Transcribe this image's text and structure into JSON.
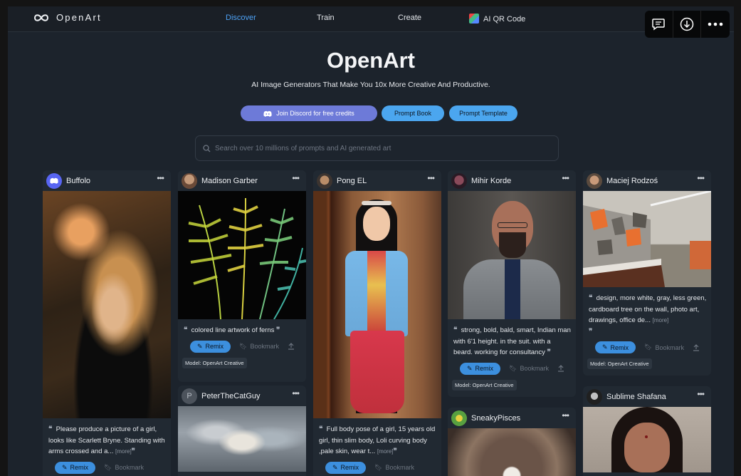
{
  "nav": {
    "brand": "OpenArt",
    "links": [
      "Discover",
      "Train",
      "Create",
      "AI QR Code"
    ],
    "active_link": "Discover",
    "accent_color": "#4ea3f7"
  },
  "hero": {
    "title": "OpenArt",
    "subtitle": "AI Image Generators That Make You 10x More Creative And Productive.",
    "buttons": {
      "discord": "Join Discord for free credits",
      "prompt_book": "Prompt Book",
      "prompt_template": "Prompt Template"
    }
  },
  "search": {
    "placeholder": "Search over 10 millions of prompts and AI generated art"
  },
  "labels": {
    "remix": "Remix",
    "bookmark": "Bookmark",
    "more": "[more]"
  },
  "cards": [
    {
      "user": "Buffolo",
      "prompt": "Please produce a picture of a girl, looks like Scarlett Bryne. Standing with arms crossed and a..."
    },
    {
      "user": "Madison Garber",
      "prompt": "colored line artwork of ferns",
      "model": "Model: OpenArt Creative"
    },
    {
      "user": "PeterTheCatGuy",
      "avatar_letter": "P"
    },
    {
      "user": "Pong EL",
      "prompt": "Full body pose of a girl, 15 years old girl, thin slim body, Loli curving body ,pale skin, wear t..."
    },
    {
      "user": "Mihir Korde",
      "prompt": "strong, bold, bald, smart, Indian man with 6'1 height. in the suit. with a beard. working for consultancy",
      "model": "Model: OpenArt Creative"
    },
    {
      "user": "SneakyPisces"
    },
    {
      "user": "Maciej Rodzoś",
      "prompt": "design, more white, gray, less green, cardboard tree on the wall, photo art, drawings, office de...",
      "model": "Model: OpenArt Creative"
    },
    {
      "user": "Sublime Shafana"
    }
  ],
  "icons": {
    "float_actions": [
      "comment-icon",
      "download-icon",
      "more-icon"
    ]
  }
}
